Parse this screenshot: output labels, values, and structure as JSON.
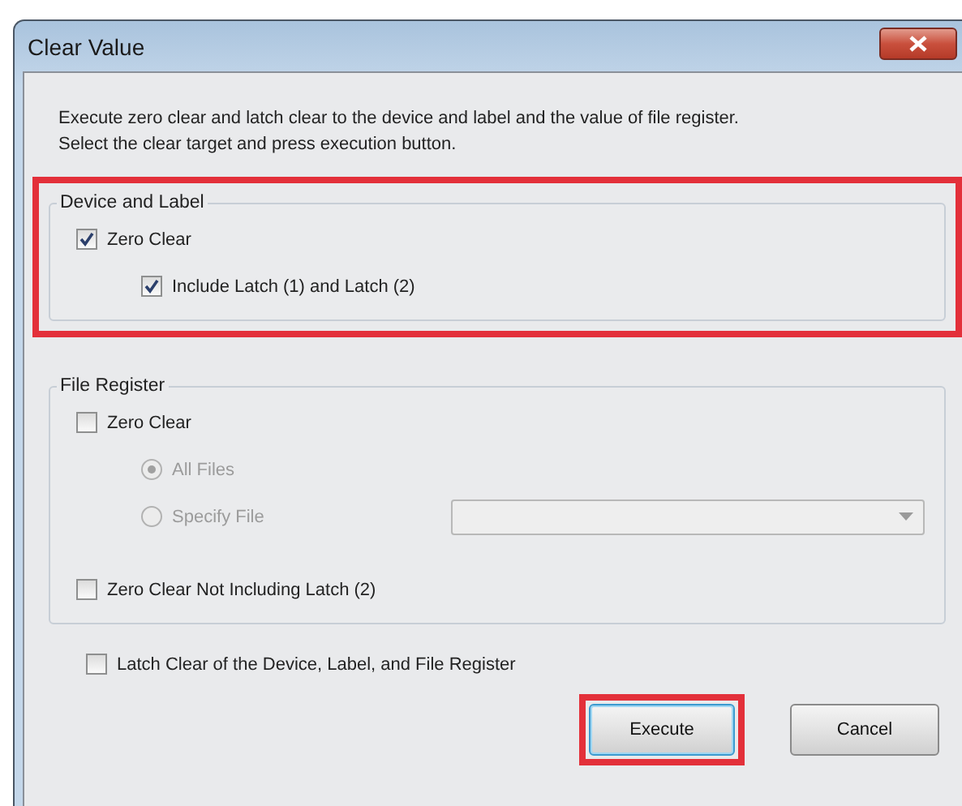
{
  "window": {
    "title": "Clear Value"
  },
  "description": [
    "Execute zero clear and latch clear to the device and label and the value of file register.",
    "Select the clear target and press execution button."
  ],
  "groups": [
    {
      "title": "Device and Label",
      "highlighted": true,
      "items": [
        {
          "kind": "checkbox",
          "label": "Zero Clear",
          "checked": true,
          "disabled": false,
          "children": [
            {
              "kind": "checkbox",
              "label": "Include Latch (1) and Latch (2)",
              "checked": true,
              "disabled": false
            }
          ]
        }
      ]
    },
    {
      "title": "File Register",
      "highlighted": false,
      "items": [
        {
          "kind": "checkbox",
          "label": "Zero Clear",
          "checked": false,
          "disabled": false,
          "children": [
            {
              "kind": "radio",
              "label": "All Files",
              "selected": true,
              "disabled": true
            },
            {
              "kind": "radio",
              "label": "Specify File",
              "selected": false,
              "disabled": true,
              "dropdown": {
                "disabled": true
              }
            }
          ]
        },
        {
          "kind": "checkbox",
          "label": "Zero Clear Not Including Latch (2)",
          "checked": false,
          "disabled": false
        }
      ]
    }
  ],
  "options": [
    {
      "kind": "checkbox",
      "label": "Latch Clear of the Device, Label, and File Register",
      "checked": false,
      "disabled": false
    }
  ],
  "buttons": [
    {
      "label": "Execute",
      "default": true,
      "highlighted": true
    },
    {
      "label": "Cancel",
      "default": false,
      "highlighted": false
    }
  ]
}
